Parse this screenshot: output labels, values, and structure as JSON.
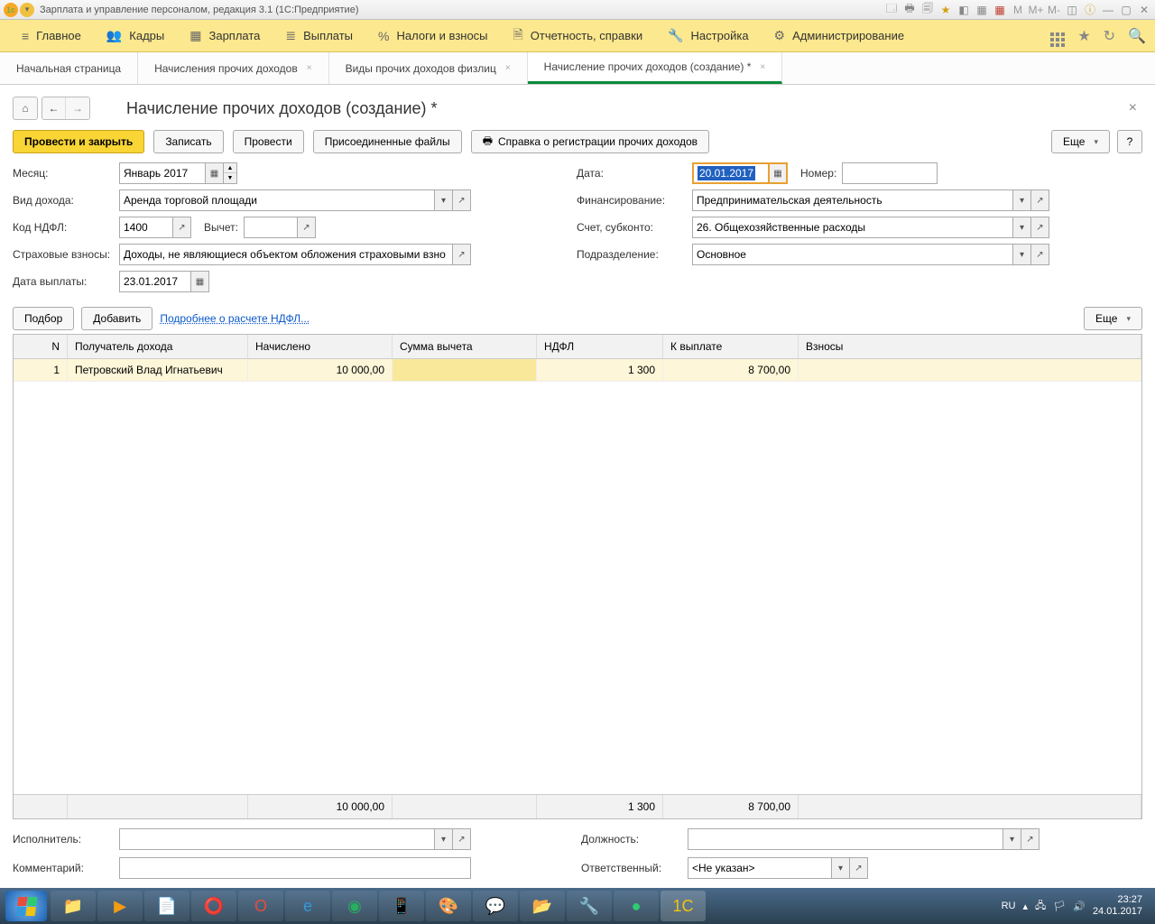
{
  "titlebar": {
    "text": "Зарплата и управление персоналом, редакция 3.1  (1С:Предприятие)"
  },
  "mainmenu": {
    "items": [
      {
        "icon": "≡",
        "label": "Главное"
      },
      {
        "icon": "👥",
        "label": "Кадры"
      },
      {
        "icon": "▦",
        "label": "Зарплата"
      },
      {
        "icon": "≣",
        "label": "Выплаты"
      },
      {
        "icon": "%",
        "label": "Налоги и взносы"
      },
      {
        "icon": "🗎",
        "label": "Отчетность, справки"
      },
      {
        "icon": "🔧",
        "label": "Настройка"
      },
      {
        "icon": "⚙",
        "label": "Администрирование"
      }
    ]
  },
  "tabs": [
    {
      "label": "Начальная страница",
      "closable": false
    },
    {
      "label": "Начисления прочих доходов",
      "closable": true
    },
    {
      "label": "Виды прочих доходов физлиц",
      "closable": true
    },
    {
      "label": "Начисление прочих доходов (создание) *",
      "closable": true,
      "active": true
    }
  ],
  "page": {
    "title": "Начисление прочих доходов (создание) *",
    "toolbar": {
      "post_close": "Провести и закрыть",
      "write": "Записать",
      "post": "Провести",
      "files": "Присоединенные файлы",
      "ref": "Справка о регистрации прочих доходов",
      "more": "Еще"
    },
    "labels": {
      "month": "Месяц:",
      "date": "Дата:",
      "number": "Номер:",
      "income_type": "Вид дохода:",
      "financing": "Финансирование:",
      "ndfl_code": "Код НДФЛ:",
      "deduction": "Вычет:",
      "account": "Счет, субконто:",
      "insurance": "Страховые взносы:",
      "department": "Подразделение:",
      "payout_date": "Дата выплаты:",
      "executor": "Исполнитель:",
      "position": "Должность:",
      "comment": "Комментарий:",
      "responsible": "Ответственный:"
    },
    "fields": {
      "month": "Январь 2017",
      "date": "20.01.2017",
      "number": "",
      "income_type": "Аренда торговой площади",
      "financing": "Предпринимательская деятельность",
      "ndfl_code": "1400",
      "deduction": "",
      "account": "26. Общехозяйственные расходы",
      "insurance": "Доходы, не являющиеся объектом обложения страховыми взно",
      "department": "Основное",
      "payout_date": "23.01.2017",
      "executor": "",
      "position": "",
      "comment": "",
      "responsible": "<Не указан>"
    },
    "tablebar": {
      "select": "Подбор",
      "add": "Добавить",
      "link": "Подробнее о расчете НДФЛ...",
      "more": "Еще"
    },
    "grid": {
      "headers": {
        "n": "N",
        "recipient": "Получатель дохода",
        "accrued": "Начислено",
        "deduction": "Сумма вычета",
        "ndfl": "НДФЛ",
        "payout": "К выплате",
        "contrib": "Взносы"
      },
      "rows": [
        {
          "n": "1",
          "recipient": "Петровский Влад Игнатьевич",
          "accrued": "10 000,00",
          "deduction": "",
          "ndfl": "1 300",
          "payout": "8 700,00",
          "contrib": ""
        }
      ],
      "totals": {
        "accrued": "10 000,00",
        "ndfl": "1 300",
        "payout": "8 700,00"
      }
    }
  },
  "tray": {
    "lang": "RU",
    "time": "23:27",
    "date": "24.01.2017"
  }
}
